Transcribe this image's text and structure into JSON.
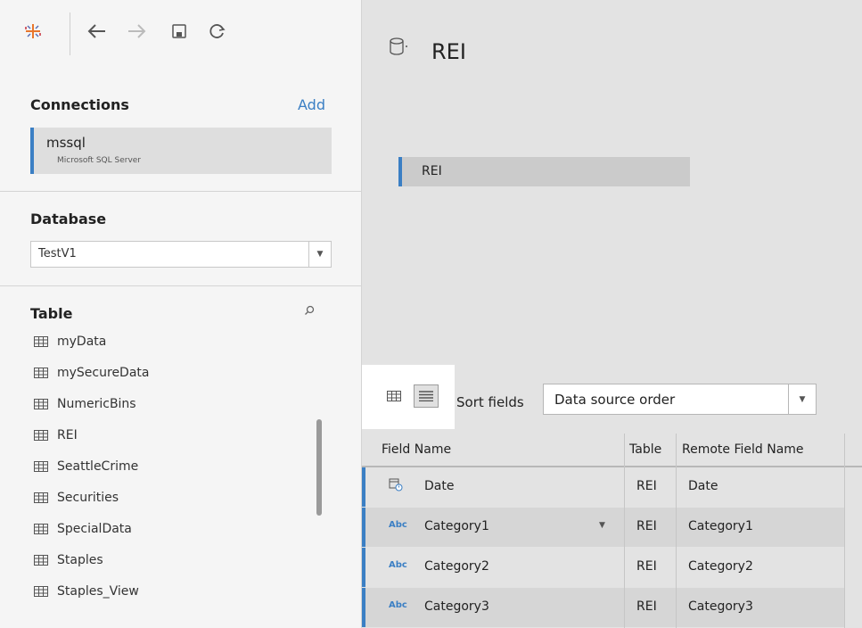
{
  "toolbar": {
    "icons": [
      "tableau-logo-icon",
      "back-arrow-icon",
      "forward-arrow-icon",
      "save-icon",
      "refresh-icon"
    ]
  },
  "sidebar": {
    "connections_title": "Connections",
    "add_label": "Add",
    "connection": {
      "name": "mssql",
      "type": "Microsoft SQL Server"
    },
    "database_title": "Database",
    "database_value": "TestV1",
    "table_title": "Table",
    "tables": [
      "myData",
      "mySecureData",
      "NumericBins",
      "REI",
      "SeattleCrime",
      "Securities",
      "SpecialData",
      "Staples",
      "Staples_View"
    ]
  },
  "main": {
    "datasource_title": "REI",
    "canvas_table": "REI",
    "sort_label": "Sort fields",
    "sort_value": "Data source order",
    "grid": {
      "headers": [
        "Field Name",
        "Table",
        "Remote Field Name"
      ],
      "rows": [
        {
          "icon": "date",
          "field": "Date",
          "table": "REI",
          "remote": "Date"
        },
        {
          "icon": "Abc",
          "field": "Category1",
          "table": "REI",
          "remote": "Category1"
        },
        {
          "icon": "Abc",
          "field": "Category2",
          "table": "REI",
          "remote": "Category2"
        },
        {
          "icon": "Abc",
          "field": "Category3",
          "table": "REI",
          "remote": "Category3"
        }
      ]
    }
  },
  "colors": {
    "accent": "#3b7fc4",
    "panel": "#e3e3e3",
    "sidebar": "#f5f5f5"
  }
}
